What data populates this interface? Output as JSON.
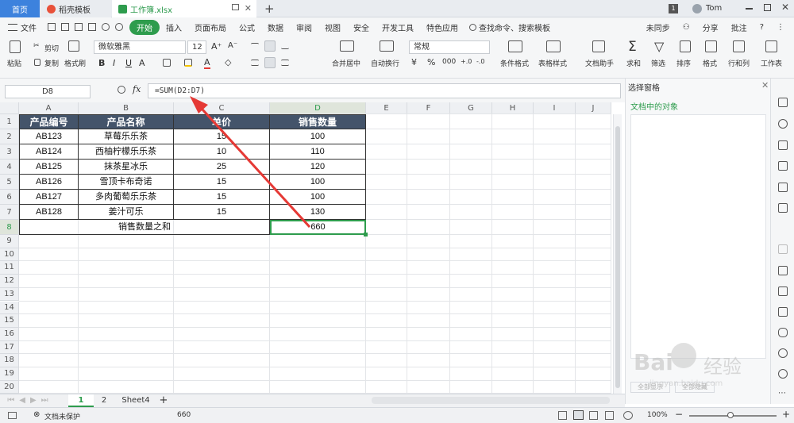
{
  "tabs": {
    "home": "首页",
    "template": "稻壳模板",
    "workbook": "工作簿.xlsx",
    "new_tab": "+"
  },
  "user": {
    "badge": "1",
    "name": "Tom"
  },
  "menu": [
    "文件",
    "开始",
    "插入",
    "页面布局",
    "公式",
    "数据",
    "审阅",
    "视图",
    "安全",
    "开发工具",
    "特色应用"
  ],
  "search": "查找命令、搜索模板",
  "right_menu": {
    "sync": "未同步",
    "share": "分享",
    "annotate": "批注",
    "help": "?"
  },
  "toolbar": {
    "paste": "粘贴",
    "cut": "剪切",
    "copy": "复制",
    "format_painter": "格式刷",
    "font_name": "微软雅黑",
    "font_size": "12",
    "merge": "合并居中",
    "wrap": "自动换行",
    "number_format": "常规",
    "conditional": "条件格式",
    "table_style": "表格样式",
    "doc_helper": "文档助手",
    "sum": "求和",
    "filter": "筛选",
    "sort": "排序",
    "format": "格式",
    "rowcol": "行和列",
    "worksheet": "工作表"
  },
  "formula_bar": {
    "cell_ref": "D8",
    "fx": "fx",
    "formula": "=SUM(D2:D7)"
  },
  "columns": [
    "A",
    "B",
    "C",
    "D",
    "E",
    "F",
    "G",
    "H",
    "I",
    "J"
  ],
  "rows": [
    "1",
    "2",
    "3",
    "4",
    "5",
    "6",
    "7",
    "8",
    "9",
    "10",
    "11",
    "12",
    "13",
    "14",
    "15",
    "16",
    "17",
    "18",
    "19",
    "20"
  ],
  "table": {
    "headers": [
      "产品编号",
      "产品名称",
      "单价",
      "销售数量"
    ],
    "rows": [
      [
        "AB123",
        "草莓乐乐茶",
        "15",
        "100"
      ],
      [
        "AB124",
        "西柚柠檬乐乐茶",
        "10",
        "110"
      ],
      [
        "AB125",
        "抹茶星冰乐",
        "25",
        "120"
      ],
      [
        "AB126",
        "雪顶卡布奇诺",
        "15",
        "100"
      ],
      [
        "AB127",
        "多肉葡萄乐乐茶",
        "15",
        "100"
      ],
      [
        "AB128",
        "姜汁可乐",
        "15",
        "130"
      ]
    ],
    "total_label": "销售数量之和",
    "total_value": "660"
  },
  "pane": {
    "title": "选择窗格",
    "objects": "文档中的对象",
    "show_all": "全部显示",
    "hide_all": "全部隐藏"
  },
  "sheets": [
    "1",
    "2",
    "Sheet4"
  ],
  "status": {
    "protect": "文档未保护",
    "sum_value": "660",
    "zoom": "100%"
  },
  "watermark": {
    "brand": "Bai",
    "brand2": "经验",
    "url": "jingyan.baidu.com"
  },
  "colors": {
    "header_fill": "#44546a",
    "accent": "#2e9c4d",
    "arrow": "#e53935",
    "home_tab": "#3d82dd"
  }
}
